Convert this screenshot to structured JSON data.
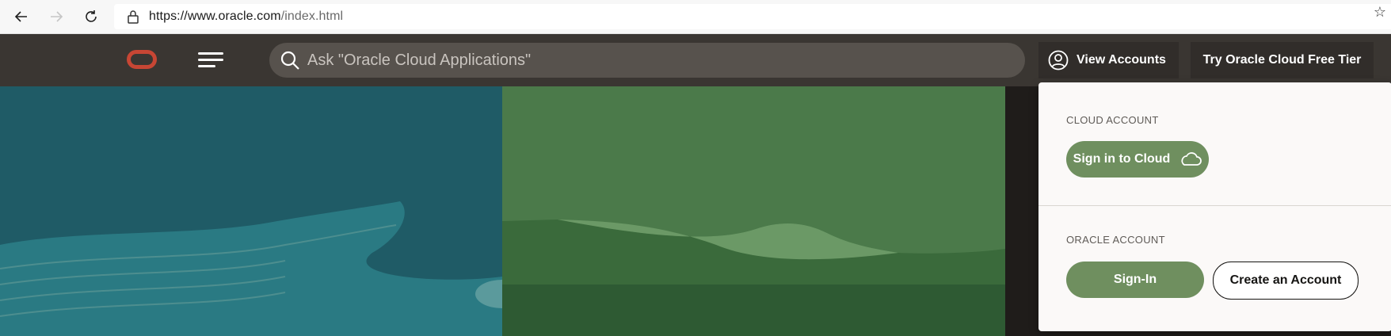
{
  "browser": {
    "url_main": "https://www.oracle.com",
    "url_path": "/index.html",
    "icons": [
      "back-arrow-icon",
      "forward-arrow-icon",
      "refresh-icon",
      "lock-icon",
      "star-icon"
    ]
  },
  "header": {
    "search_placeholder": "Ask \"Oracle Cloud Applications\"",
    "view_accounts_label": "View Accounts",
    "free_tier_label": "Try Oracle Cloud Free Tier"
  },
  "dropdown": {
    "cloud_account": {
      "heading": "CLOUD ACCOUNT",
      "sign_in_cloud_label": "Sign in to Cloud"
    },
    "oracle_account": {
      "heading": "ORACLE ACCOUNT",
      "sign_in_label": "Sign-In",
      "create_account_label": "Create an Account"
    }
  },
  "colors": {
    "header_bg": "#3a3632",
    "logo_red": "#c74634",
    "button_green": "#6f8f5f",
    "hero_teal": "#1f5b66",
    "hero_green": "#4b7a4a"
  }
}
